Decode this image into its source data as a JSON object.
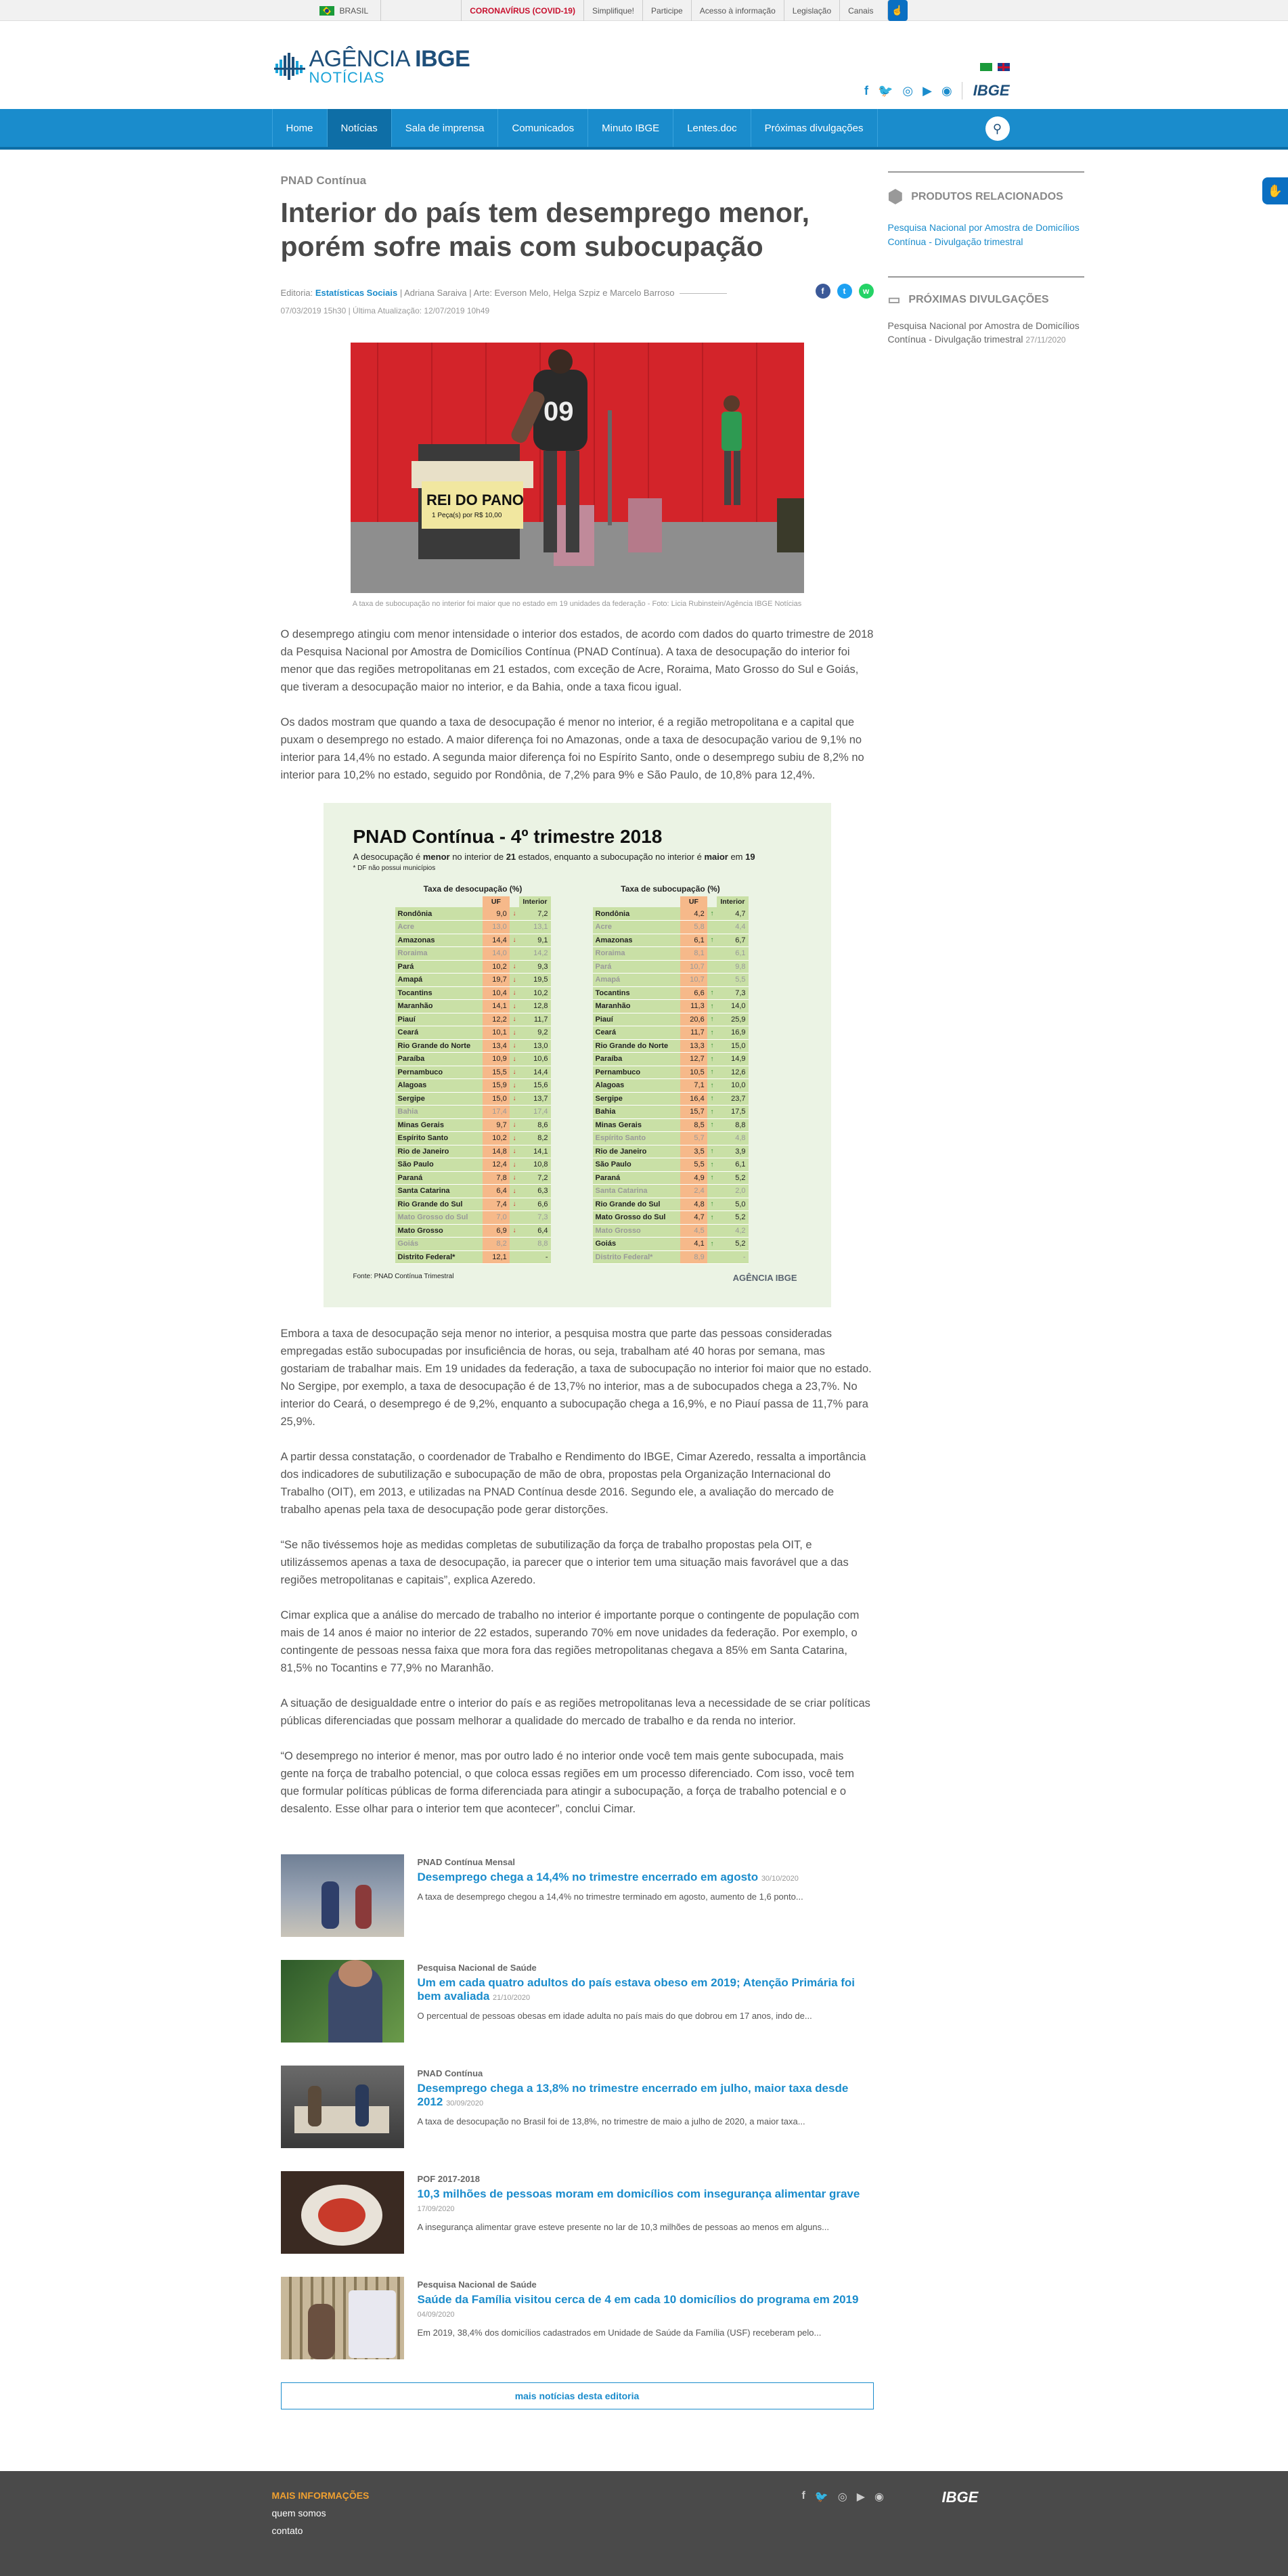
{
  "topbar": {
    "brasil": "BRASIL",
    "links": [
      "CORONAVÍRUS (COVID-19)",
      "Simplifique!",
      "Participe",
      "Acesso à informação",
      "Legislação",
      "Canais"
    ]
  },
  "header": {
    "logo_line1a": "AGÊNCIA",
    "logo_line1b": "IBGE",
    "logo_line2": "NOTÍCIAS",
    "ibge": "IBGE"
  },
  "nav": {
    "items": [
      "Home",
      "Notícias",
      "Sala de imprensa",
      "Comunicados",
      "Minuto IBGE",
      "Lentes.doc",
      "Próximas divulgações"
    ]
  },
  "article": {
    "kicker": "PNAD Contínua",
    "title": "Interior do país tem desemprego menor, porém sofre mais com subocupação",
    "meta_prefix": "Editoria: ",
    "editoria": "Estatísticas Sociais",
    "authors": " | Adriana Saraiva | Arte: Everson Melo, Helga Szpiz e Marcelo Barroso",
    "dates": "07/03/2019 15h30 | Última Atualização: 12/07/2019 10h49",
    "photo_sign": "REI DO PANO",
    "photo_price": "1 Peça(s) por R$ 10,00",
    "photo_jersey": "09",
    "caption": "A taxa de subocupação no interior foi maior que no estado em 19 unidades da federação - Foto: Licia Rubinstein/Agência IBGE Notícias",
    "paragraphs": [
      "O desemprego atingiu com menor intensidade o interior dos estados, de acordo com dados do quarto trimestre de 2018 da Pesquisa Nacional por Amostra de Domicílios Contínua (PNAD Contínua). A taxa de desocupação do interior foi menor que das regiões metropolitanas em 21 estados, com exceção de Acre, Roraima, Mato Grosso do Sul e Goiás, que tiveram a desocupação maior no interior, e da Bahia, onde a taxa ficou igual.",
      "Os dados mostram que quando a taxa de desocupação é menor no interior, é a região metropolitana e a capital que puxam o desemprego no estado. A maior diferença foi no Amazonas, onde a taxa de desocupação variou de 9,1% no interior para 14,4% no estado. A segunda maior diferença foi no Espírito Santo, onde o desemprego subiu de 8,2% no interior para 10,2% no estado, seguido por Rondônia, de 7,2% para 9% e São Paulo, de 10,8% para 12,4%."
    ],
    "paragraphs2": [
      "Embora a taxa de desocupação seja menor no interior, a pesquisa mostra que parte das pessoas consideradas empregadas estão subocupadas por insuficiência de horas, ou seja, trabalham até 40 horas por semana, mas gostariam de trabalhar mais. Em 19 unidades da federação, a taxa de subocupação no interior foi maior que no estado. No Sergipe, por exemplo, a taxa de desocupação é de 13,7% no interior, mas a de subocupados chega a 23,7%. No interior do Ceará, o desemprego é de 9,2%, enquanto a subocupação chega a 16,9%, e no Piauí passa de 11,7% para 25,9%.",
      "A partir dessa constatação, o coordenador de Trabalho e Rendimento do IBGE, Cimar Azeredo, ressalta a importância dos indicadores de subutilização e subocupação de mão de obra, propostas pela Organização Internacional do Trabalho (OIT), em 2013, e utilizadas na PNAD Contínua desde 2016. Segundo ele, a avaliação do mercado de trabalho apenas pela taxa de desocupação pode gerar distorções.",
      "“Se não tivéssemos hoje as medidas completas de subutilização da força de trabalho propostas pela OIT, e utilizássemos apenas a taxa de desocupação, ia parecer que o interior tem uma situação mais favorável que a das regiões metropolitanas e capitais”, explica Azeredo.",
      "Cimar explica que a análise do mercado de trabalho no interior é importante porque o contingente de população com mais de 14 anos é maior no interior de 22 estados, superando 70% em nove unidades da federação. Por exemplo, o contingente de pessoas nessa faixa que mora fora das regiões metropolitanas chegava a 85% em Santa Catarina, 81,5% no Tocantins e 77,9% no Maranhão.",
      "A situação de desigualdade entre o interior do país e as regiões metropolitanas leva a necessidade de se criar políticas públicas diferenciadas que possam melhorar a qualidade do mercado de trabalho e da renda no interior.",
      "“O desemprego no interior é menor, mas por outro lado é no interior onde você tem mais gente subocupada, mais gente na força de trabalho potencial, o que coloca essas regiões em um processo diferenciado. Com isso, você tem que formular políticas públicas de forma diferenciada para atingir a subocupação, a força de trabalho potencial e o desalento. Esse olhar para o interior tem que acontecer”, conclui Cimar."
    ]
  },
  "infographic": {
    "title": "PNAD Contínua - 4º trimestre 2018",
    "sub_a": "A  desocupação é ",
    "sub_b": "menor",
    "sub_c": " no interior de ",
    "sub_d": "21",
    "sub_e": " estados, enquanto a subocupação no interior é ",
    "sub_f": "maior",
    "sub_g": " em ",
    "sub_h": "19",
    "note": "* DF não possui municípios",
    "left_head": "Taxa de desocupação (%)",
    "right_head": "Taxa de subocupação (%)",
    "col_uf": "UF",
    "col_int": "Interior",
    "source": "Fonte: PNAD Contínua Trimestral",
    "logo": "AGÊNCIA IBGE",
    "rows_left": [
      [
        "Rondônia",
        "9,0",
        "down",
        "7,2",
        ""
      ],
      [
        "Acre",
        "13,0",
        "",
        "13,1",
        "m"
      ],
      [
        "Amazonas",
        "14,4",
        "down",
        "9,1",
        ""
      ],
      [
        "Roraima",
        "14,0",
        "",
        "14,2",
        "m"
      ],
      [
        "Pará",
        "10,2",
        "down",
        "9,3",
        ""
      ],
      [
        "Amapá",
        "19,7",
        "down",
        "19,5",
        ""
      ],
      [
        "Tocantins",
        "10,4",
        "down",
        "10,2",
        ""
      ],
      [
        "Maranhão",
        "14,1",
        "down",
        "12,8",
        ""
      ],
      [
        "Piauí",
        "12,2",
        "down",
        "11,7",
        ""
      ],
      [
        "Ceará",
        "10,1",
        "down",
        "9,2",
        ""
      ],
      [
        "Rio Grande do Norte",
        "13,4",
        "down",
        "13,0",
        ""
      ],
      [
        "Paraíba",
        "10,9",
        "down",
        "10,6",
        ""
      ],
      [
        "Pernambuco",
        "15,5",
        "down",
        "14,4",
        ""
      ],
      [
        "Alagoas",
        "15,9",
        "down",
        "15,6",
        ""
      ],
      [
        "Sergipe",
        "15,0",
        "down",
        "13,7",
        ""
      ],
      [
        "Bahia",
        "17,4",
        "",
        "17,4",
        "m"
      ],
      [
        "Minas Gerais",
        "9,7",
        "down",
        "8,6",
        ""
      ],
      [
        "Espírito Santo",
        "10,2",
        "down",
        "8,2",
        ""
      ],
      [
        "Rio de Janeiro",
        "14,8",
        "down",
        "14,1",
        ""
      ],
      [
        "São Paulo",
        "12,4",
        "down",
        "10,8",
        ""
      ],
      [
        "Paraná",
        "7,8",
        "down",
        "7,2",
        ""
      ],
      [
        "Santa Catarina",
        "6,4",
        "down",
        "6,3",
        ""
      ],
      [
        "Rio Grande do Sul",
        "7,4",
        "down",
        "6,6",
        ""
      ],
      [
        "Mato Grosso do Sul",
        "7,0",
        "",
        "7,3",
        "m"
      ],
      [
        "Mato Grosso",
        "6,9",
        "down",
        "6,4",
        ""
      ],
      [
        "Goiás",
        "8,2",
        "",
        "8,8",
        "m"
      ],
      [
        "Distrito Federal*",
        "12,1",
        "",
        "-",
        ""
      ]
    ],
    "rows_right": [
      [
        "Rondônia",
        "4,2",
        "up",
        "4,7",
        ""
      ],
      [
        "Acre",
        "5,8",
        "",
        "4,4",
        "m"
      ],
      [
        "Amazonas",
        "6,1",
        "up",
        "6,7",
        ""
      ],
      [
        "Roraima",
        "8,1",
        "",
        "6,1",
        "m"
      ],
      [
        "Pará",
        "10,7",
        "",
        "9,8",
        "m"
      ],
      [
        "Amapá",
        "10,7",
        "",
        "5,5",
        "m"
      ],
      [
        "Tocantins",
        "6,6",
        "up",
        "7,3",
        ""
      ],
      [
        "Maranhão",
        "11,3",
        "up",
        "14,0",
        ""
      ],
      [
        "Piauí",
        "20,6",
        "up",
        "25,9",
        ""
      ],
      [
        "Ceará",
        "11,7",
        "up",
        "16,9",
        ""
      ],
      [
        "Rio Grande do Norte",
        "13,3",
        "up",
        "15,0",
        ""
      ],
      [
        "Paraíba",
        "12,7",
        "up",
        "14,9",
        ""
      ],
      [
        "Pernambuco",
        "10,5",
        "up",
        "12,6",
        ""
      ],
      [
        "Alagoas",
        "7,1",
        "up",
        "10,0",
        ""
      ],
      [
        "Sergipe",
        "16,4",
        "up",
        "23,7",
        ""
      ],
      [
        "Bahia",
        "15,7",
        "up",
        "17,5",
        ""
      ],
      [
        "Minas Gerais",
        "8,5",
        "up",
        "8,8",
        ""
      ],
      [
        "Espírito Santo",
        "5,7",
        "",
        "4,8",
        "m"
      ],
      [
        "Rio de Janeiro",
        "3,5",
        "up",
        "3,9",
        ""
      ],
      [
        "São Paulo",
        "5,5",
        "up",
        "6,1",
        ""
      ],
      [
        "Paraná",
        "4,9",
        "up",
        "5,2",
        ""
      ],
      [
        "Santa Catarina",
        "2,4",
        "",
        "2,0",
        "m"
      ],
      [
        "Rio Grande do Sul",
        "4,8",
        "up",
        "5,0",
        ""
      ],
      [
        "Mato Grosso do Sul",
        "4,7",
        "up",
        "5,2",
        ""
      ],
      [
        "Mato Grosso",
        "4,5",
        "",
        "4,2",
        "m"
      ],
      [
        "Goiás",
        "4,1",
        "up",
        "5,2",
        ""
      ],
      [
        "Distrito Federal*",
        "8,9",
        "",
        "-",
        "m"
      ]
    ]
  },
  "related": [
    {
      "cat": "PNAD Contínua Mensal",
      "title": "Desemprego chega a 14,4% no trimestre encerrado em agosto",
      "date": "30/10/2020",
      "summary": "A taxa de desemprego chegou a 14,4% no trimestre terminado em agosto, aumento de 1,6 ponto..."
    },
    {
      "cat": "Pesquisa Nacional de Saúde",
      "title": "Um em cada quatro adultos do país estava obeso em 2019; Atenção Primária foi bem avaliada",
      "date": "21/10/2020",
      "summary": "O percentual de pessoas obesas em idade adulta no país mais do que dobrou em 17 anos, indo de..."
    },
    {
      "cat": "PNAD Contínua",
      "title": "Desemprego chega a 13,8% no trimestre encerrado em julho, maior taxa desde 2012",
      "date": "30/09/2020",
      "summary": "A taxa de desocupação no Brasil foi de 13,8%, no trimestre de maio a julho de 2020, a maior taxa..."
    },
    {
      "cat": "POF 2017-2018",
      "title": "10,3 milhões de pessoas moram em domicílios com insegurança alimentar grave",
      "date": "17/09/2020",
      "summary": "A insegurança alimentar grave esteve presente no lar de 10,3 milhões de pessoas ao menos em alguns..."
    },
    {
      "cat": "Pesquisa Nacional de Saúde",
      "title": "Saúde da Família visitou cerca de 4 em cada 10 domicílios do programa em 2019",
      "date": "04/09/2020",
      "summary": "Em 2019, 38,4% dos domicílios cadastrados em Unidade de Saúde da Família (USF) receberam pelo..."
    }
  ],
  "more_button": "mais notícias desta editoria",
  "sidebar": {
    "produtos_head": "PRODUTOS RELACIONADOS",
    "produtos_link": "Pesquisa Nacional por Amostra de Domicílios Contínua - Divulgação trimestral",
    "proximas_head": "PRÓXIMAS DIVULGAÇÕES",
    "proximas_text": "Pesquisa Nacional por Amostra de Domicílios Contínua - Divulgação trimestral",
    "proximas_date": "27/11/2020"
  },
  "footer": {
    "head": "MAIS INFORMAÇÕES",
    "link1": "quem somos",
    "link2": "contato",
    "ibge": "IBGE"
  }
}
